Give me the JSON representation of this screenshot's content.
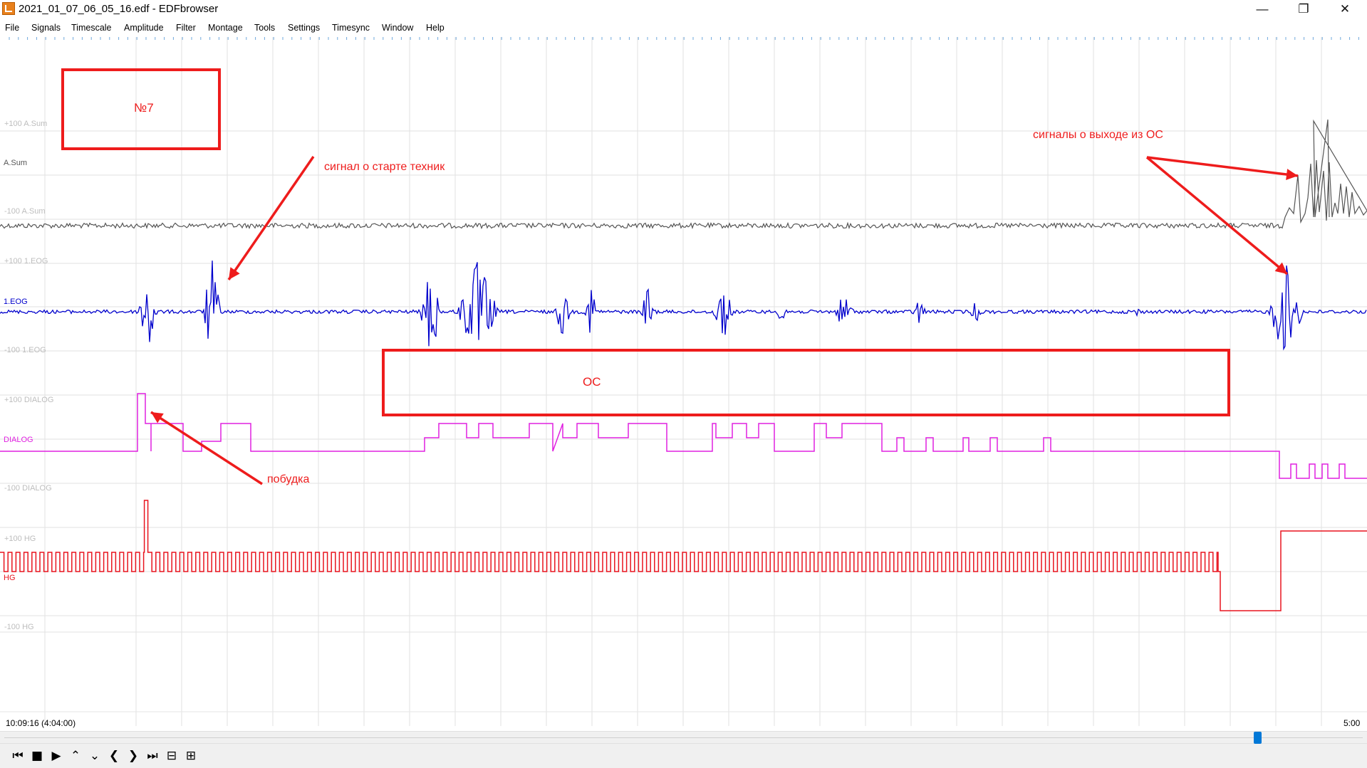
{
  "window": {
    "title": "2021_01_07_06_05_16.edf - EDFbrowser",
    "controls": {
      "minimize": "—",
      "restore": "❐",
      "close": "✕"
    }
  },
  "menu": {
    "file": "File",
    "signals": "Signals",
    "timescale": "Timescale",
    "amplitude": "Amplitude",
    "filter": "Filter",
    "montage": "Montage",
    "tools": "Tools",
    "settings": "Settings",
    "timesync": "Timesync",
    "window": "Window",
    "help": "Help"
  },
  "signals": {
    "asum": {
      "label": "A.Sum",
      "top": "+100 A.Sum",
      "bottom": "-100 A.Sum",
      "color": "#555555"
    },
    "eog": {
      "label": "1.EOG",
      "top": "+100 1.EOG",
      "bottom": "-100 1.EOG",
      "color": "#0000cc"
    },
    "dialog": {
      "label": "DIALOG",
      "top": "+100 DIALOG",
      "bottom": "-100 DIALOG",
      "color": "#e020e0"
    },
    "hg": {
      "label": "HG",
      "top": "+100 HG",
      "bottom": "-100 HG",
      "color": "#e8141e"
    }
  },
  "annotations": {
    "number_box": "№7",
    "start_signal": "сигнал о старте техник",
    "exit_signals": "сигналы о выходе из ОС",
    "os_box": "ОС",
    "wakeup": "побудка",
    "color": "#ee1c1c"
  },
  "timeline": {
    "start": "10:09:16 (4:04:00)",
    "end": "5:00",
    "scroll_position": 0.925
  },
  "toolbar_icons": [
    {
      "name": "jump-to-start-icon",
      "glyph": "⏮"
    },
    {
      "name": "stop-icon",
      "glyph": "■"
    },
    {
      "name": "play-icon",
      "glyph": "▶"
    },
    {
      "name": "amplitude-up-icon",
      "glyph": "⌃"
    },
    {
      "name": "amplitude-down-icon",
      "glyph": "⌄"
    },
    {
      "name": "page-back-icon",
      "glyph": "❮"
    },
    {
      "name": "page-forward-icon",
      "glyph": "❯"
    },
    {
      "name": "jump-to-end-icon",
      "glyph": "⏭"
    },
    {
      "name": "zoom-out-icon",
      "glyph": "⊟"
    },
    {
      "name": "zoom-in-icon",
      "glyph": "⊞"
    }
  ]
}
